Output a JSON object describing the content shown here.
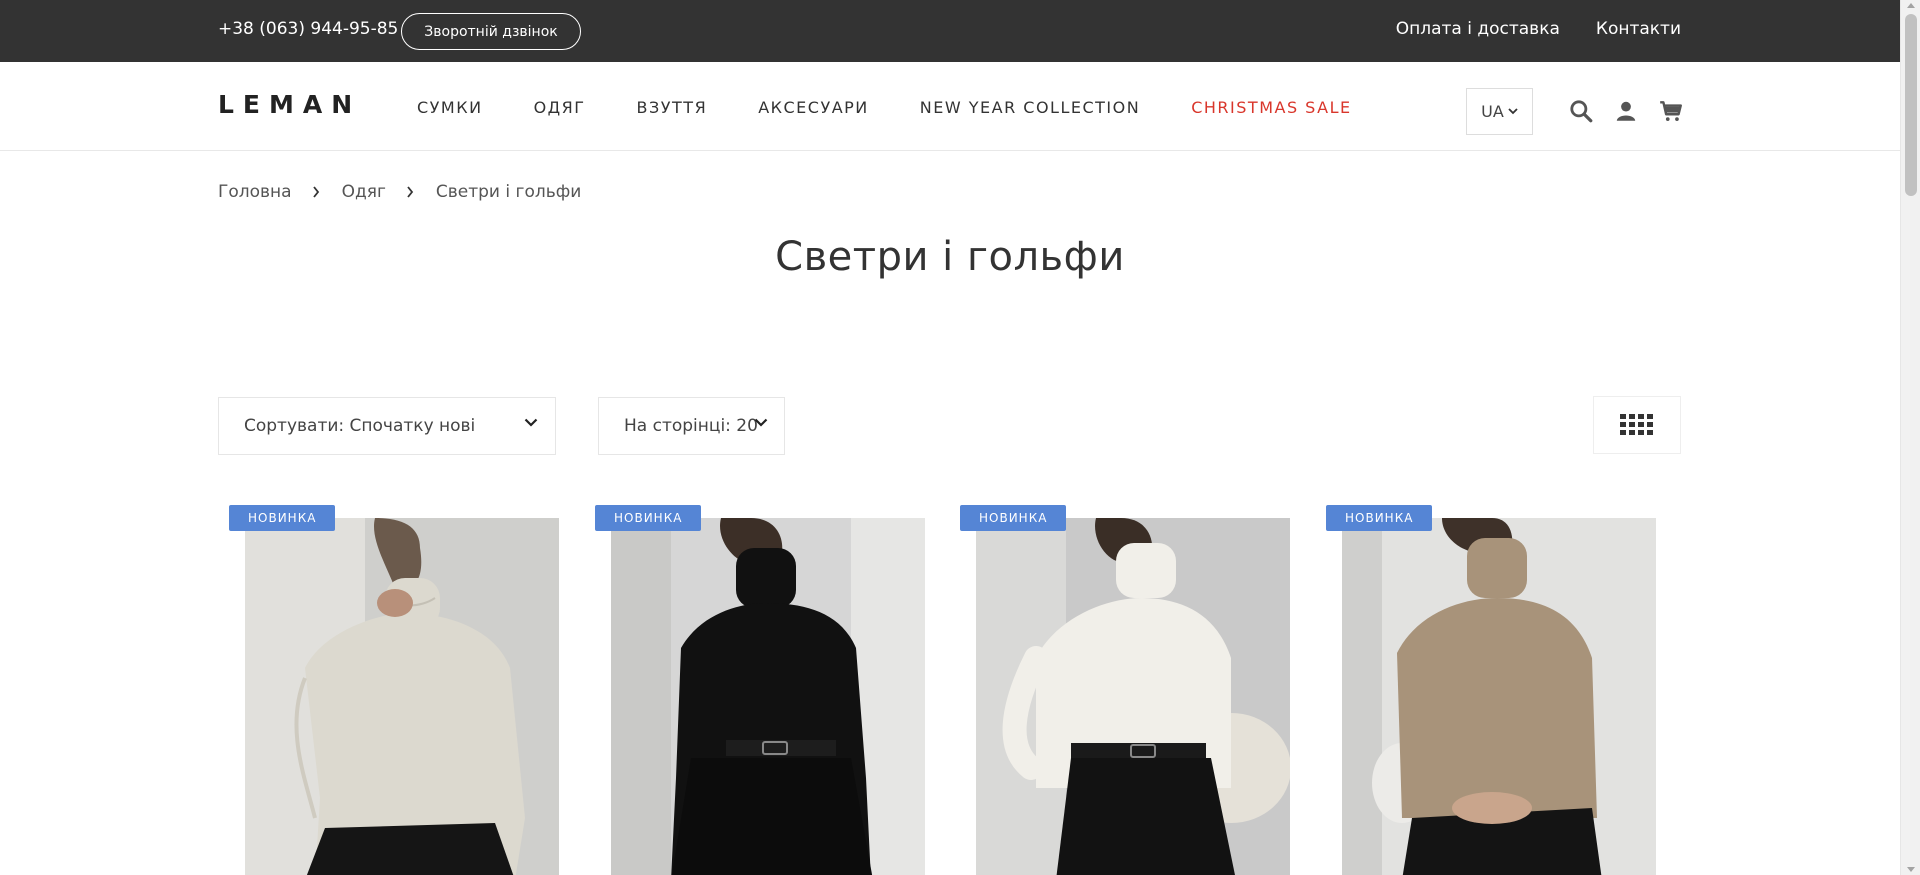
{
  "topbar": {
    "phone": "+38 (063) 944-95-85",
    "callback_label": "Зворотній дзвінок",
    "links": [
      "Оплата і доставка",
      "Контакти"
    ]
  },
  "header": {
    "logo": "LEMAN",
    "nav": [
      "СУМКИ",
      "ОДЯГ",
      "ВЗУТТЯ",
      "АКСЕСУАРИ",
      "NEW YEAR COLLECTION",
      "CHRISTMAS SALE"
    ],
    "sale_color": "#d9362b",
    "language": "UA"
  },
  "breadcrumb": [
    "Головна",
    "Одяг",
    "Светри і гольфи"
  ],
  "page_title": "Светри і гольфи",
  "toolbar": {
    "sort_label": "Сортувати: Спочатку нові",
    "perpage_label": "На сторінці: 20"
  },
  "products": [
    {
      "badge": "НОВИНКА",
      "sweater_color": "#dcd9cf",
      "bg_color": "#cfcfcc"
    },
    {
      "badge": "НОВИНКА",
      "sweater_color": "#111111",
      "bg_color": "#d6d6d6"
    },
    {
      "badge": "НОВИНКА",
      "sweater_color": "#f1efe9",
      "bg_color": "#c9c9c9"
    },
    {
      "badge": "НОВИНКА",
      "sweater_color": "#a8937a",
      "bg_color": "#e2e2e0"
    }
  ],
  "colors": {
    "topbar": "#333333",
    "badge": "#5585d5"
  }
}
